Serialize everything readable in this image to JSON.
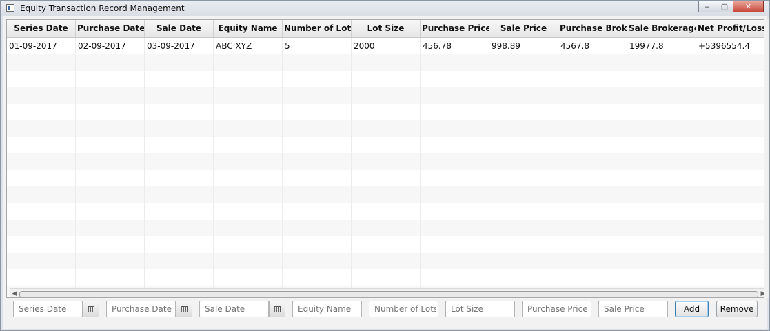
{
  "window": {
    "title": "Equity Transaction Record Management",
    "controls": {
      "minimize": "‒",
      "maximize": "▢",
      "close": "✕"
    }
  },
  "table": {
    "columns": [
      "Series Date",
      "Purchase Date",
      "Sale Date",
      "Equity Name",
      "Number of Lots",
      "Lot Size",
      "Purchase Price",
      "Sale Price",
      "Purchase Brok...",
      "Sale Brokerage",
      "Net Profit/Loss"
    ],
    "rows": [
      [
        "01-09-2017",
        "02-09-2017",
        "03-09-2017",
        "ABC XYZ",
        "5",
        "2000",
        "456.78",
        "998.89",
        "4567.8",
        "19977.8",
        "+5396554.4"
      ]
    ],
    "empty_row_count": 15
  },
  "form": {
    "series_date_placeholder": "Series Date",
    "purchase_date_placeholder": "Purchase Date",
    "sale_date_placeholder": "Sale Date",
    "equity_name_placeholder": "Equity Name",
    "number_of_lots_placeholder": "Number of Lots",
    "lot_size_placeholder": "Lot Size",
    "purchase_price_placeholder": "Purchase Price",
    "sale_price_placeholder": "Sale Price",
    "add_label": "Add",
    "remove_label": "Remove"
  },
  "icons": {
    "calendar": "calendar-icon",
    "app": "app-window-icon"
  }
}
